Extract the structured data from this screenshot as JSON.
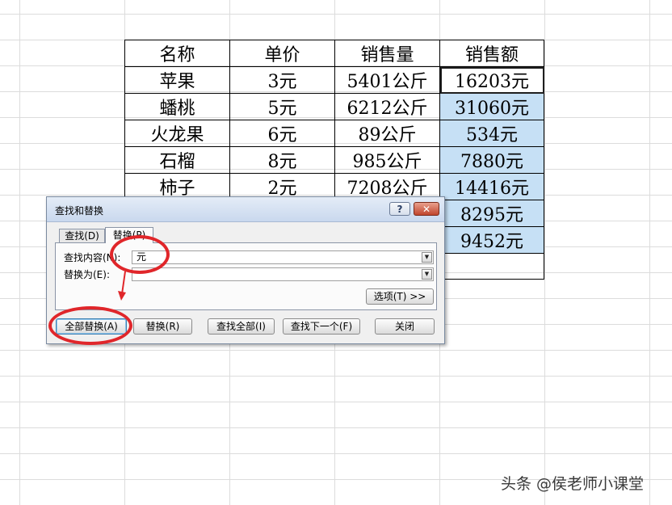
{
  "table": {
    "headers": [
      "名称",
      "单价",
      "销售量",
      "销售额"
    ],
    "rows": [
      [
        "苹果",
        "3元",
        "5401公斤",
        "16203元"
      ],
      [
        "蟠桃",
        "5元",
        "6212公斤",
        "31060元"
      ],
      [
        "火龙果",
        "6元",
        "89公斤",
        "534元"
      ],
      [
        "石榴",
        "8元",
        "985公斤",
        "7880元"
      ],
      [
        "柿子",
        "2元",
        "7208公斤",
        "14416元"
      ]
    ],
    "extra_amounts": [
      "8295元",
      "9452元"
    ]
  },
  "dialog": {
    "title": "查找和替换",
    "help": "?",
    "close": "✕",
    "tabs": {
      "find": "查找(D)",
      "replace": "替换(P)"
    },
    "find_label": "查找内容(N):",
    "find_value": "元",
    "replace_label": "替换为(E):",
    "replace_value": "",
    "options_button": "选项(T) >>",
    "buttons": {
      "replace_all": "全部替换(A)",
      "replace": "替换(R)",
      "find_all": "查找全部(I)",
      "find_next": "查找下一个(F)",
      "close": "关闭"
    }
  },
  "watermark": "头条 @侯老师小课堂",
  "colors": {
    "selection": "#c6e0f5",
    "annotation": "#e0262a"
  }
}
